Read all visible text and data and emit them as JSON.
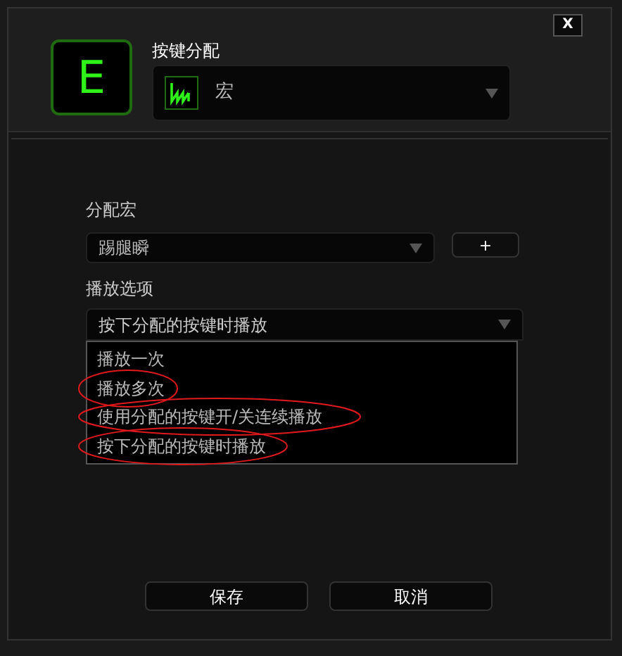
{
  "close_button": "X",
  "key": {
    "label": "E"
  },
  "assignment": {
    "label": "按键分配",
    "value": "宏"
  },
  "macro": {
    "label": "分配宏",
    "value": "踢腿瞬",
    "add_button": "+"
  },
  "playback": {
    "label": "播放选项",
    "value": "按下分配的按键时播放",
    "expanded": true,
    "options": [
      {
        "label": "播放一次",
        "circled": false
      },
      {
        "label": "播放多次",
        "circled": true
      },
      {
        "label": "使用分配的按键开/关连续播放",
        "circled": true
      },
      {
        "label": "按下分配的按键时播放",
        "circled": true
      }
    ]
  },
  "buttons": [
    "保存",
    "取消"
  ]
}
